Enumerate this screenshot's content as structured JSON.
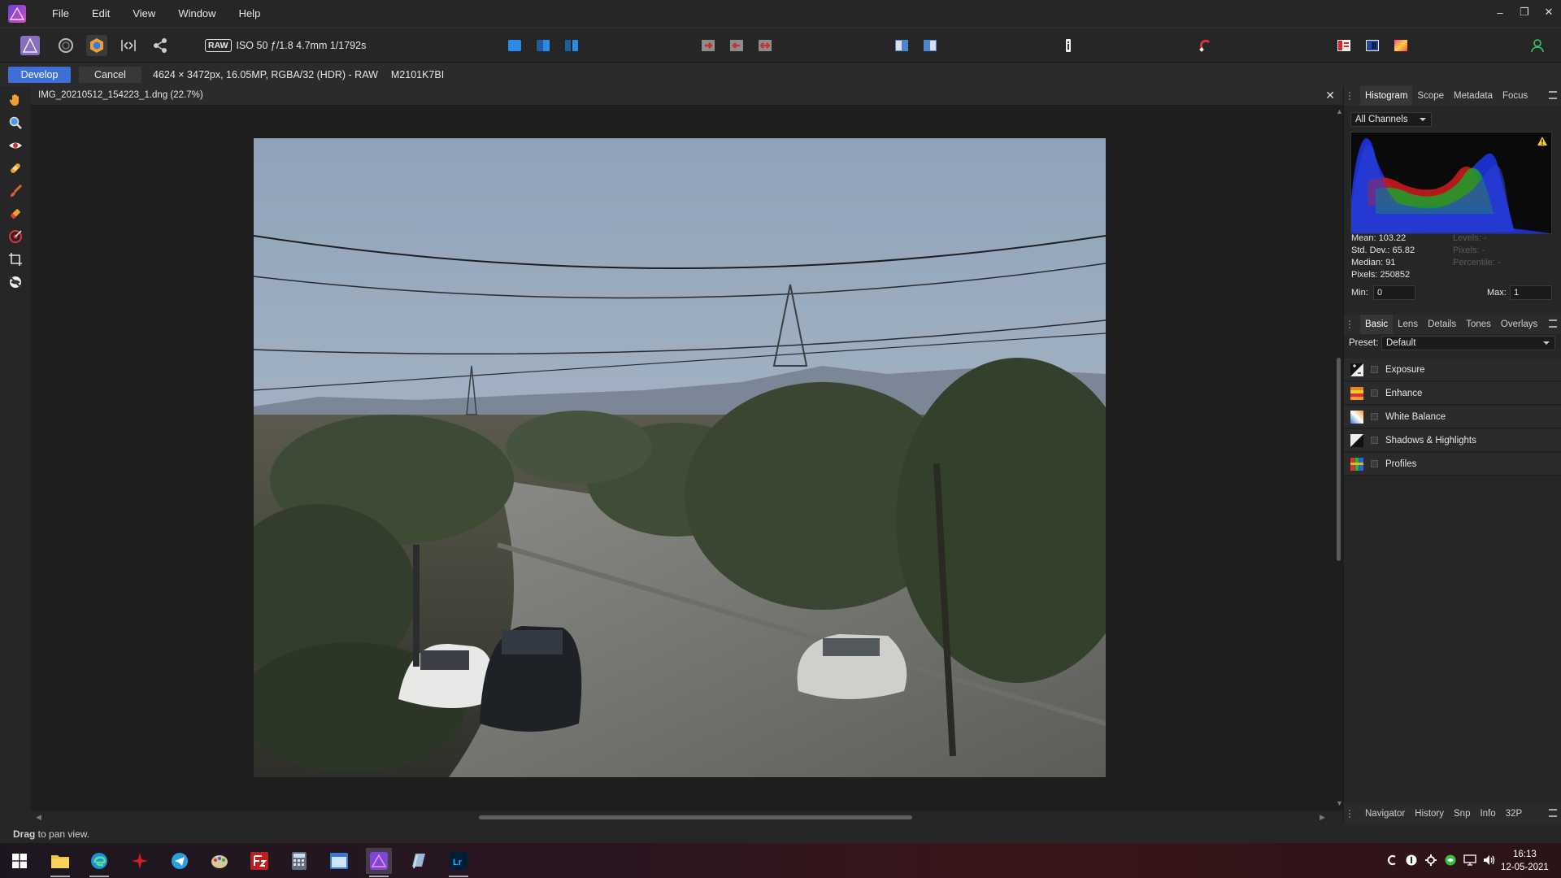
{
  "menubar": {
    "items": [
      "File",
      "Edit",
      "View",
      "Window",
      "Help"
    ]
  },
  "window_controls": {
    "minimize": "–",
    "restore": "❐",
    "close": "✕"
  },
  "toolbar": {
    "raw_badge": "RAW",
    "exposure_info": "ISO 50 ƒ/1.8 4.7mm 1/1792s"
  },
  "context": {
    "develop_label": "Develop",
    "cancel_label": "Cancel",
    "image_info": "4624 × 3472px, 16.05MP, RGBA/32 (HDR) - RAW",
    "camera_model": "M2101K7BI"
  },
  "document": {
    "title": "IMG_20210512_154223_1.dng (22.7%)",
    "close": "✕"
  },
  "top_panel": {
    "tabs": [
      "Histogram",
      "Scope",
      "Metadata",
      "Focus"
    ],
    "channel_select": "All Channels",
    "warning_icon": "warning-icon",
    "stats": {
      "mean": "Mean: 103.22",
      "std_dev": "Std. Dev.: 65.82",
      "median": "Median: 91",
      "pixels": "Pixels: 250852"
    },
    "stats_disabled": {
      "levels": "Levels: -",
      "pixels": "Pixels: -",
      "percentile": "Percentile: -"
    },
    "min_label": "Min:",
    "min_value": "0",
    "max_label": "Max:",
    "max_value": "1"
  },
  "mid_panel": {
    "tabs": [
      "Basic",
      "Lens",
      "Details",
      "Tones",
      "Overlays"
    ],
    "preset_label": "Preset:",
    "preset_value": "Default",
    "adjustments": [
      "Exposure",
      "Enhance",
      "White Balance",
      "Shadows & Highlights",
      "Profiles"
    ]
  },
  "bottom_panel": {
    "tabs": [
      "Navigator",
      "History",
      "Snp",
      "Info",
      "32P"
    ]
  },
  "status": {
    "bold": "Drag",
    "rest": " to pan view."
  },
  "taskbar": {
    "time": "16:13",
    "date": "12-05-2021"
  },
  "colors": {
    "accent": "#3d6fd6",
    "panel_bg": "#262626",
    "canvas_bg": "#1e1e1e"
  }
}
